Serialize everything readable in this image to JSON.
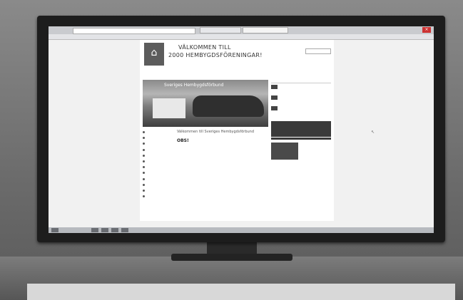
{
  "page": {
    "welcome_line1": "VÄLKOMMEN TILL",
    "welcome_line2": "2000 HEMBYGDSFÖRENINGAR!",
    "hero_title": "Sveriges Hembygdsförbund",
    "article_title": "Välkommen till Sveriges Hembygdsförbund",
    "obs_heading": "OBS!"
  },
  "colors": {
    "screen_bg": "#f1f1f1",
    "bezel": "#1d1d1d",
    "promo_box": "#3a3a3a"
  },
  "icons": [
    "cursor-icon",
    "logo-icon"
  ]
}
